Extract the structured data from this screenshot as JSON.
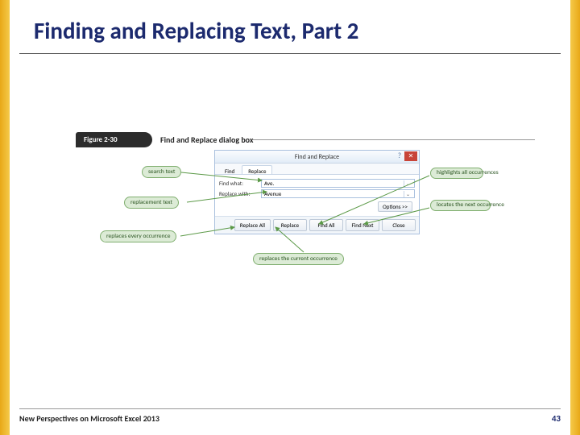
{
  "title": "Finding and Replacing Text, Part 2",
  "figure": {
    "num": "Figure 2-30",
    "caption": "Find and Replace dialog box"
  },
  "dialog": {
    "title": "Find and Replace",
    "tabs": [
      "Find",
      "Replace"
    ],
    "find_label": "Find what:",
    "find_value": "Ave.",
    "replace_label": "Replace with:",
    "replace_value": "Avenue",
    "options": "Options >>",
    "buttons": [
      "Replace All",
      "Replace",
      "Find All",
      "Find Next",
      "Close"
    ]
  },
  "callouts": [
    "search text",
    "replacement text",
    "replaces every occurrence",
    "replaces the current occurrence",
    "highlights all occurrences",
    "locates the next occurrence"
  ],
  "footer": {
    "text": "New Perspectives on Microsoft Excel 2013",
    "page": "43"
  }
}
